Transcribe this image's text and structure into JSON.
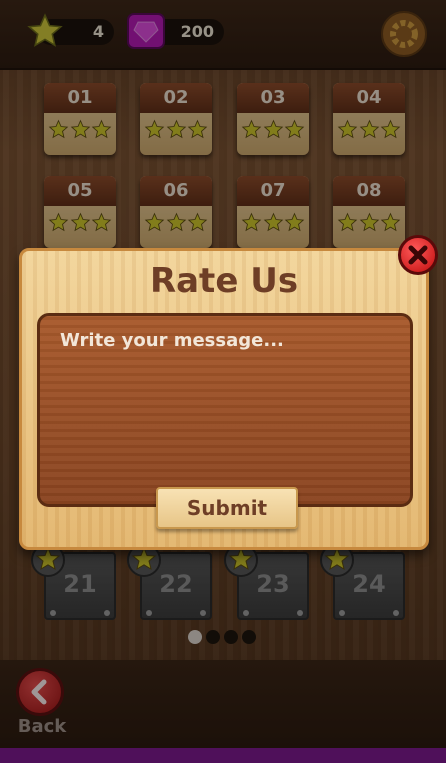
{
  "topbar": {
    "stars_count": "4",
    "gems_count": "200",
    "icons": {
      "star": "star-icon",
      "gem": "gem-icon",
      "settings": "gear-icon"
    }
  },
  "levels": {
    "unlocked": [
      {
        "label": "01",
        "stars": 3
      },
      {
        "label": "02",
        "stars": 3
      },
      {
        "label": "03",
        "stars": 3
      },
      {
        "label": "04",
        "stars": 3
      },
      {
        "label": "05",
        "stars": 3
      },
      {
        "label": "06",
        "stars": 3
      },
      {
        "label": "07",
        "stars": 3
      },
      {
        "label": "08",
        "stars": 3
      }
    ],
    "locked": [
      {
        "label": "21"
      },
      {
        "label": "22"
      },
      {
        "label": "23"
      },
      {
        "label": "24"
      }
    ]
  },
  "pagination": {
    "pages": 4,
    "active": 1
  },
  "dialog": {
    "title": "Rate Us",
    "placeholder": "Write your message...",
    "submit_label": "Submit",
    "close_icon": "close-icon"
  },
  "footer": {
    "back_label": "Back",
    "back_icon": "back-arrow-icon"
  },
  "colors": {
    "accent_red": "#c00c0c",
    "wood_dark": "#5e2e18",
    "star_yellow": "#d8cc44",
    "purple_strip": "#7a1a8a"
  }
}
